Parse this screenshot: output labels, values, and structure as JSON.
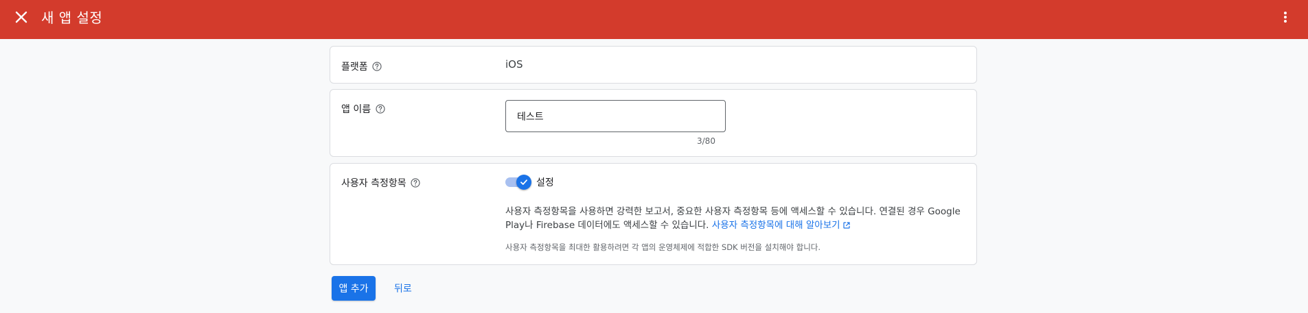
{
  "header": {
    "title": "새 앱 설정",
    "close_icon": "close-icon",
    "more_icon": "more-vert-icon",
    "background_color": "#d33b2c"
  },
  "platform": {
    "label": "플랫폼",
    "value": "iOS",
    "help_icon": "help-circle-icon"
  },
  "app_name": {
    "label": "앱 이름",
    "value": "테스트",
    "counter": "3/80",
    "help_icon": "help-circle-icon"
  },
  "user_metrics": {
    "label": "사용자 측정항목",
    "help_icon": "help-circle-icon",
    "toggle_on": true,
    "toggle_label": "설정",
    "description": "사용자 측정항목을 사용하면 강력한 보고서, 중요한 사용자 측정항목 등에 액세스할 수 있습니다. 연결된 경우 Google Play나 Firebase 데이터에도 액세스할 수 있습니다. ",
    "link_text": "사용자 측정항목에 대해 알아보기",
    "link_icon": "open-in-new-icon",
    "note": "사용자 측정항목을 최대한 활용하려면 각 앱의 운영체제에 적합한 SDK 버전을 설치해야 합니다."
  },
  "actions": {
    "add_app": "앱 추가",
    "back": "뒤로"
  },
  "colors": {
    "accent": "#1a73e8",
    "toggle_track": "#a8c0f0"
  }
}
